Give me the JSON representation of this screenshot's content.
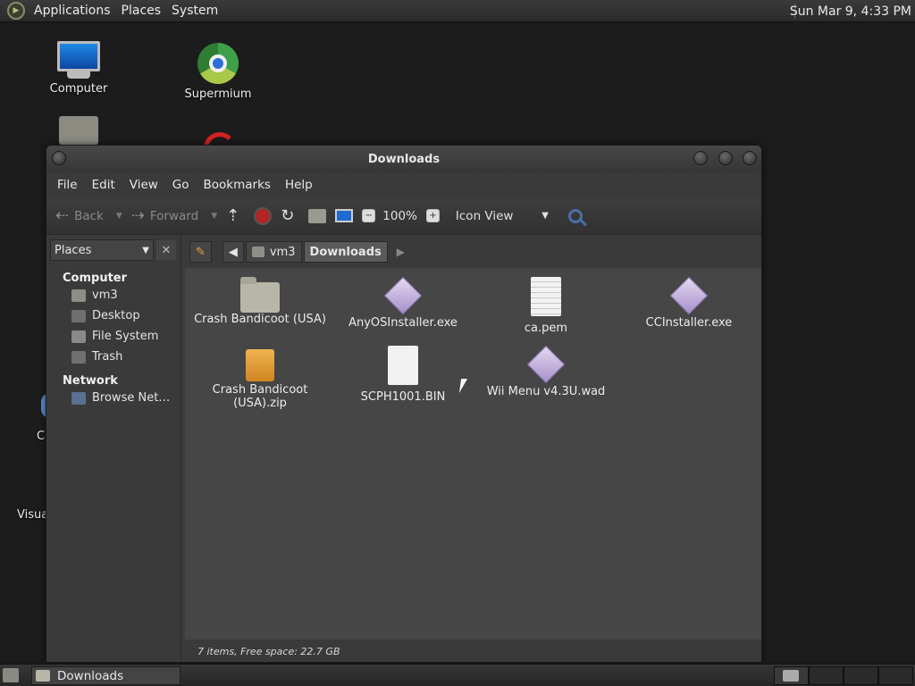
{
  "top_panel": {
    "menus": [
      "Applications",
      "Places",
      "System"
    ],
    "clock": "Sun Mar 9,  4:33 PM"
  },
  "desktop": {
    "icons": [
      {
        "label": "Computer",
        "icon": "monitor-icon"
      },
      {
        "label": "Supermium",
        "icon": "browser-icon"
      }
    ],
    "partial_labels": [
      "C",
      "Visua"
    ]
  },
  "window": {
    "title": "Downloads",
    "menu": [
      "File",
      "Edit",
      "View",
      "Go",
      "Bookmarks",
      "Help"
    ],
    "toolbar": {
      "back": "Back",
      "forward": "Forward",
      "zoom": "100%",
      "view_mode": "Icon View"
    },
    "sidebar": {
      "selector": "Places",
      "sections": [
        {
          "title": "Computer",
          "items": [
            "vm3",
            "Desktop",
            "File System",
            "Trash"
          ]
        },
        {
          "title": "Network",
          "items": [
            "Browse Net…"
          ]
        }
      ]
    },
    "path": [
      "vm3",
      "Downloads"
    ],
    "files": [
      {
        "name": "Crash Bandicoot (USA)",
        "type": "folder"
      },
      {
        "name": "AnyOSInstaller.exe",
        "type": "exe"
      },
      {
        "name": "ca.pem",
        "type": "text"
      },
      {
        "name": "CCInstaller.exe",
        "type": "exe"
      },
      {
        "name": "Crash Bandicoot (USA).zip",
        "type": "zip"
      },
      {
        "name": "SCPH1001.BIN",
        "type": "blank"
      },
      {
        "name": "Wii Menu v4.3U.wad",
        "type": "exe"
      }
    ],
    "status": "7 items, Free space: 22.7 GB"
  },
  "bottom_panel": {
    "task": "Downloads"
  }
}
